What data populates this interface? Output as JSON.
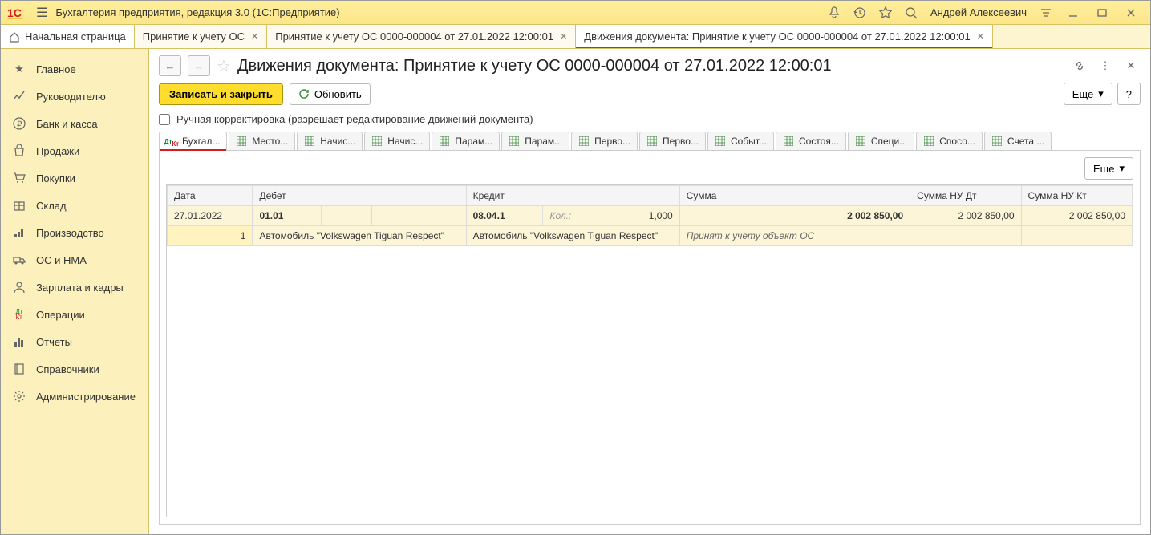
{
  "titlebar": {
    "title": "Бухгалтерия предприятия, редакция 3.0  (1С:Предприятие)",
    "user": "Андрей Алексеевич"
  },
  "tabs": {
    "home": "Начальная страница",
    "t1": "Принятие к учету ОС",
    "t2": "Принятие к учету ОС 0000-000004 от 27.01.2022 12:00:01",
    "t3": "Движения документа: Принятие к учету ОС 0000-000004 от 27.01.2022 12:00:01"
  },
  "sidebar": {
    "items": [
      {
        "label": "Главное"
      },
      {
        "label": "Руководителю"
      },
      {
        "label": "Банк и касса"
      },
      {
        "label": "Продажи"
      },
      {
        "label": "Покупки"
      },
      {
        "label": "Склад"
      },
      {
        "label": "Производство"
      },
      {
        "label": "ОС и НМА"
      },
      {
        "label": "Зарплата и кадры"
      },
      {
        "label": "Операции"
      },
      {
        "label": "Отчеты"
      },
      {
        "label": "Справочники"
      },
      {
        "label": "Администрирование"
      }
    ]
  },
  "page": {
    "title": "Движения документа: Принятие к учету ОС 0000-000004 от 27.01.2022 12:00:01",
    "save_close": "Записать и закрыть",
    "refresh": "Обновить",
    "more": "Еще",
    "help": "?",
    "manual_edit": "Ручная корректировка (разрешает редактирование движений документа)"
  },
  "regtabs": [
    "Бухгал...",
    "Место...",
    "Начис...",
    "Начис...",
    "Парам...",
    "Парам...",
    "Перво...",
    "Перво...",
    "Событ...",
    "Состоя...",
    "Специ...",
    "Спосо...",
    "Счета ..."
  ],
  "table": {
    "headers": {
      "date": "Дата",
      "debit": "Дебет",
      "credit": "Кредит",
      "sum": "Сумма",
      "sum_nu_dt": "Сумма НУ Дт",
      "sum_nu_kt": "Сумма НУ Кт"
    },
    "row1": {
      "date": "27.01.2022",
      "debit_acc": "01.01",
      "credit_acc": "08.04.1",
      "kol_label": "Кол.:",
      "kol_val": "1,000",
      "sum": "2 002 850,00",
      "sum_nu_dt": "2 002 850,00",
      "sum_nu_kt": "2 002 850,00"
    },
    "row2": {
      "num": "1",
      "debit_obj": "Автомобиль \"Volkswagen Tiguan Respect\"",
      "credit_obj": "Автомобиль \"Volkswagen Tiguan Respect\"",
      "desc": "Принят к учету объект ОС"
    }
  }
}
